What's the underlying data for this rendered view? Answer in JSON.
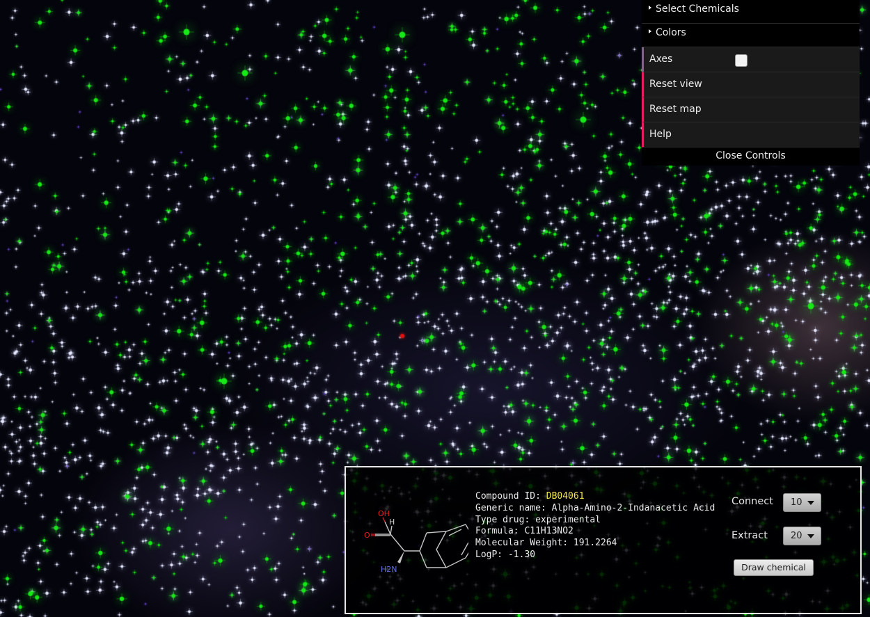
{
  "controls": {
    "folders": [
      {
        "label": "Select Chemicals"
      },
      {
        "label": "Colors"
      }
    ],
    "axes": {
      "label": "Axes",
      "checked": false
    },
    "buttons": [
      {
        "label": "Reset view"
      },
      {
        "label": "Reset map"
      },
      {
        "label": "Help"
      }
    ],
    "close_label": "Close Controls"
  },
  "info": {
    "compound_id_label": "Compound ID: ",
    "compound_id": "DB04061",
    "generic_name_line": "Generic name: Alpha-Amino-2-Indanacetic Acid",
    "type_line": "Type drug: experimental",
    "formula_line": "Formula: C11H13NO2",
    "mw_line": "Molecular Weight: 191.2264",
    "logp_line": "LogP: -1.30",
    "structure_atoms": {
      "oh": "OH",
      "o": "O",
      "h": "H",
      "nh2": "H2N"
    }
  },
  "settings": {
    "connect_label": "Connect",
    "connect_value": "10",
    "extract_label": "Extract",
    "extract_value": "20",
    "draw_button": "Draw chemical"
  },
  "colors": {
    "background": "#04040c",
    "star_white": "#e6e8ff",
    "star_green": "#18e818",
    "focus_point": "#e01010",
    "accent_function": "#e61d5f",
    "compound_id": "#f4e84a"
  }
}
